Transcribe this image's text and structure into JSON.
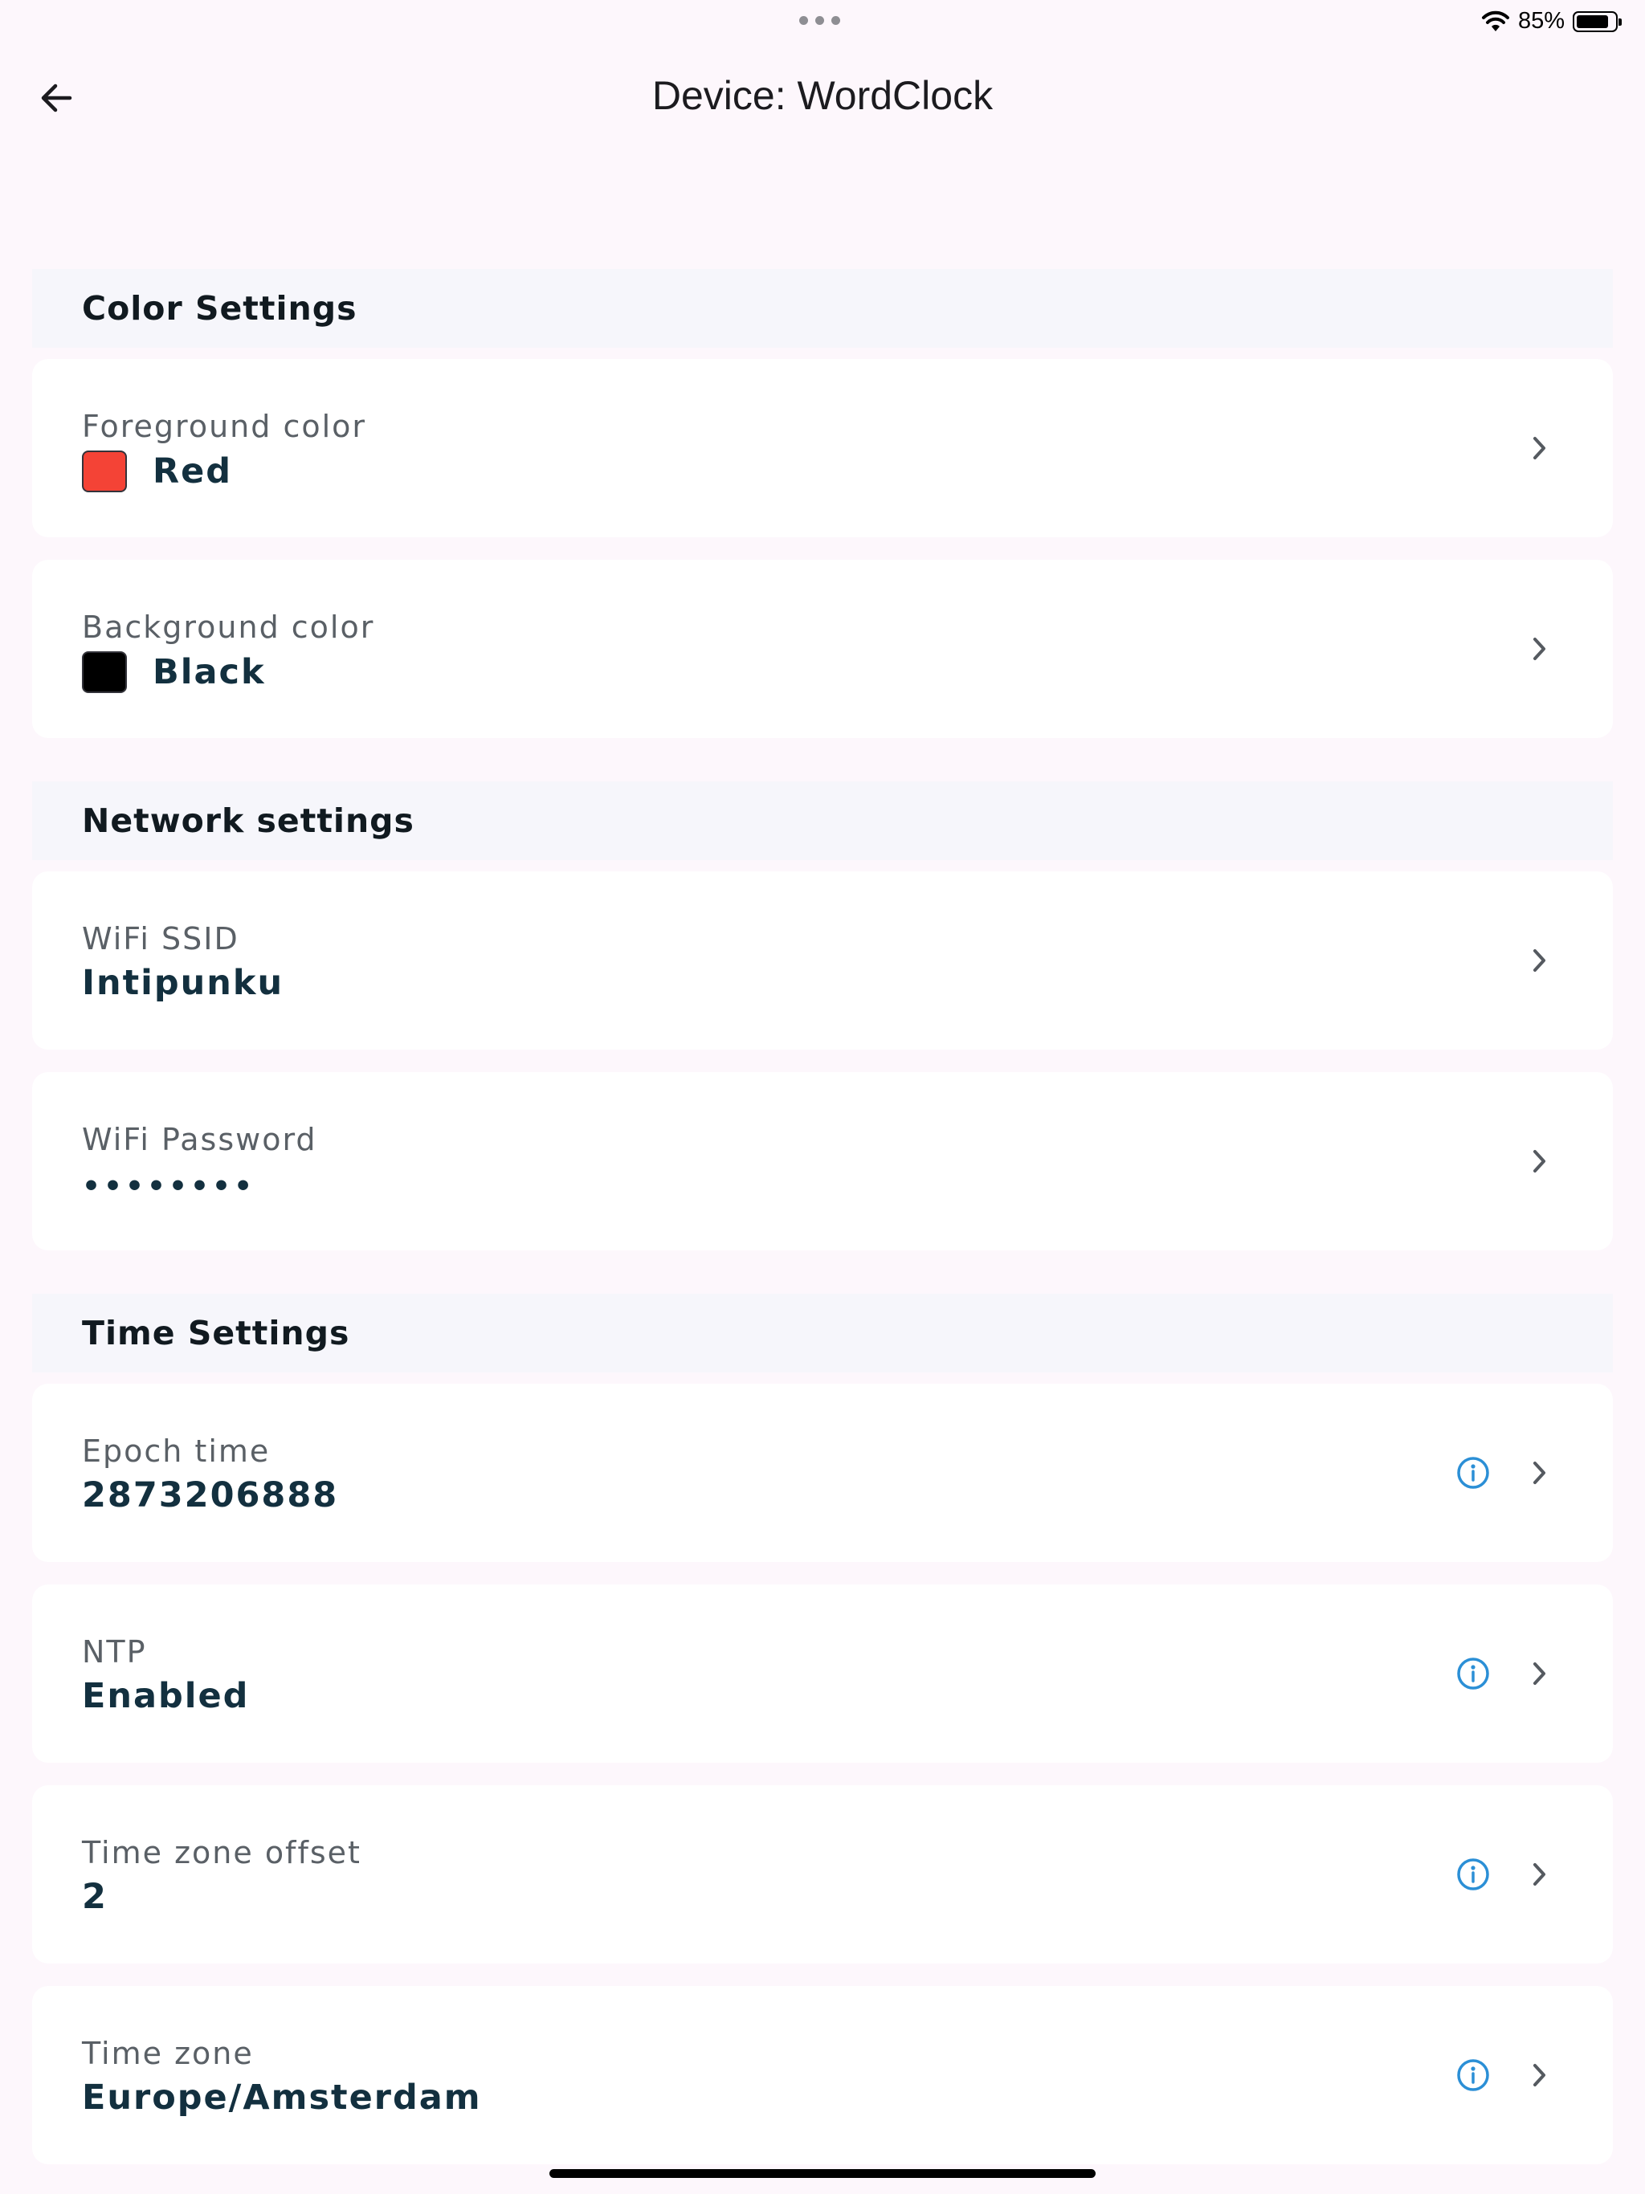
{
  "status_bar": {
    "battery_text": "85%",
    "battery_level": 0.85
  },
  "app_bar": {
    "title": "Device: WordClock",
    "back_icon": "arrow-left-icon"
  },
  "sections": {
    "color": {
      "title": "Color Settings",
      "foreground": {
        "label": "Foreground color",
        "value": "Red",
        "swatch": "#f44336"
      },
      "background": {
        "label": "Background color",
        "value": "Black",
        "swatch": "#000000"
      }
    },
    "network": {
      "title": "Network settings",
      "ssid": {
        "label": "WiFi SSID",
        "value": "Intipunku"
      },
      "password": {
        "label": "WiFi Password",
        "value": "••••••••"
      }
    },
    "time": {
      "title": "Time Settings",
      "epoch": {
        "label": "Epoch time",
        "value": "2873206888"
      },
      "ntp": {
        "label": "NTP",
        "value": "Enabled"
      },
      "offset": {
        "label": "Time zone offset",
        "value": "2"
      },
      "zone": {
        "label": "Time zone",
        "value": "Europe/Amsterdam"
      }
    }
  },
  "colors": {
    "accent_info": "#2b8fd6",
    "chevron": "#555a60",
    "background": "#fdf7fc"
  }
}
